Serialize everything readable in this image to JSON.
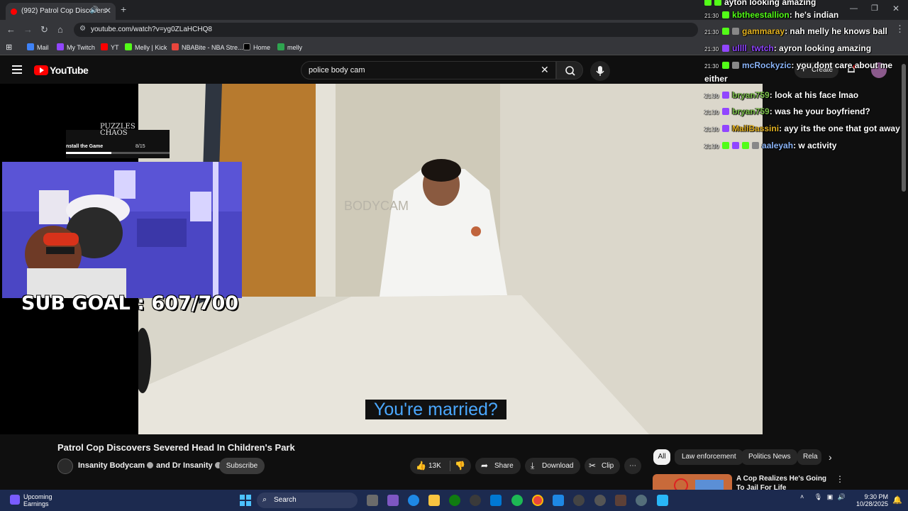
{
  "browser": {
    "tab_title": "(992) Patrol Cop Discovers",
    "url": "youtube.com/watch?v=yg0ZLaHCHQ8",
    "bookmarks": [
      {
        "label": "Mail"
      },
      {
        "label": "My Twitch"
      },
      {
        "label": "YT"
      },
      {
        "label": "Melly | Kick"
      },
      {
        "label": "NBABite - NBA Stre..."
      },
      {
        "label": "Home"
      },
      {
        "label": "melly"
      }
    ]
  },
  "youtube": {
    "logo_text": "YouTube",
    "search_value": "police body cam",
    "create_label": "Create"
  },
  "overlay": {
    "game_card_brand": "PUZZLES CHAOS",
    "game_card_text": "nstall the Game",
    "game_card_count": "8/15",
    "sub_goal": "SUB GOAL : 607/700"
  },
  "video": {
    "subtitle": "You're married?",
    "watermark": "BODYCAM",
    "title": "Patrol Cop Discovers Severed Head In Children's Park",
    "channel": "Insanity Bodycam",
    "collab": "and Dr Insanity",
    "subscribe_label": "Subscribe",
    "likes": "13K",
    "share_label": "Share",
    "download_label": "Download",
    "clip_label": "Clip"
  },
  "chips": [
    "All",
    "Law enforcement",
    "Politics News",
    "Rela"
  ],
  "recommendation": {
    "title": "A Cop Realizes He's Going To Jail For Life"
  },
  "chat": [
    {
      "time": "",
      "user": "ayton",
      "user_color": "#ffffff",
      "message": "ayton looking amazing",
      "badges": [
        "kick",
        "kick"
      ]
    },
    {
      "time": "21:30",
      "user": "kbtheestallion",
      "user_color": "#53fc18",
      "message": ": he's indian",
      "badges": [
        "kick"
      ]
    },
    {
      "time": "21:30",
      "user": "gammaray",
      "user_color": "#e6b422",
      "message": ": nah melly he knows ball",
      "badges": [
        "kick",
        "gray"
      ]
    },
    {
      "time": "21:30",
      "user": "ullll_twtch",
      "user_color": "#9146ff",
      "message": ": ayron looking amazing",
      "badges": [
        "twitch"
      ]
    },
    {
      "time": "21:30",
      "user": "mcRockyzic",
      "user_color": "#8ab4f8",
      "message": ": you dont care about me",
      "badges": [
        "kick",
        "gray"
      ]
    },
    {
      "time": "",
      "user": "",
      "user_color": "#ffffff",
      "message": "either",
      "badges": []
    },
    {
      "time": "21:30",
      "user": "bryan759",
      "user_color": "#7cc04b",
      "message": ": look at his face lmao",
      "badges": [
        "twitch"
      ]
    },
    {
      "time": "21:30",
      "user": "bryan759",
      "user_color": "#7cc04b",
      "message": ": was he your boyfriend?",
      "badges": [
        "twitch"
      ]
    },
    {
      "time": "21:30",
      "user": "MaliBassini",
      "user_color": "#e6b422",
      "message": ": ayy its the one that got away",
      "badges": [
        "twitch"
      ]
    },
    {
      "time": "21:30",
      "user": "aaleyah",
      "user_color": "#8ab4f8",
      "message": ": w activity",
      "badges": [
        "kick",
        "twitch",
        "kick",
        "gray"
      ]
    }
  ],
  "taskbar": {
    "weather_title": "Upcoming",
    "weather_sub": "Earnings",
    "search_label": "Search",
    "time": "9:30 PM",
    "date": "10/28/2025"
  },
  "colors": {
    "youtube_red": "#ff0000",
    "subtitle_text": "#4aa8ff",
    "kick_green": "#53fc18",
    "twitch_purple": "#9146ff",
    "webcam_purple": "#4b46c4"
  }
}
